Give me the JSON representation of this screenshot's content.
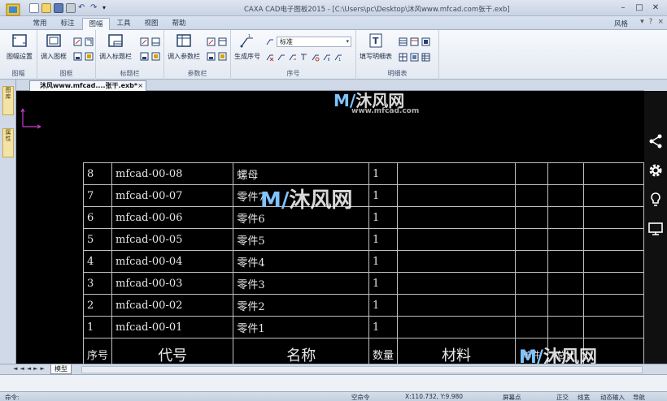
{
  "window": {
    "title": "CAXA CAD电子图板2015 - [C:\\Users\\pc\\Desktop\\沐风www.mfcad.com张干.exb]",
    "style_label": "风格"
  },
  "tabs": [
    "常用",
    "标注",
    "图幅",
    "工具",
    "视图",
    "帮助"
  ],
  "active_tab": "图幅",
  "ribbon": {
    "groups": [
      {
        "label": "图幅",
        "buttons": [
          "图幅设置"
        ]
      },
      {
        "label": "图框",
        "buttons": [
          "调入图框"
        ]
      },
      {
        "label": "标题栏",
        "buttons": [
          "调入标题栏"
        ]
      },
      {
        "label": "参数栏",
        "buttons": [
          "调入参数栏"
        ]
      },
      {
        "label": "序号",
        "buttons": [
          "生成序号"
        ],
        "dropdown_value": "标准"
      },
      {
        "label": "明细表",
        "buttons": [
          "填写明细表"
        ]
      }
    ]
  },
  "document": {
    "tab_title": "沐风www.mfcad....张干.exb*",
    "close_glyph": "×"
  },
  "left_panel": {
    "tabs": [
      "图库",
      "属性"
    ]
  },
  "bom": {
    "rows": [
      {
        "no": "8",
        "code": "mfcad-00-08",
        "name": "螺母",
        "qty": "1"
      },
      {
        "no": "7",
        "code": "mfcad-00-07",
        "name": "零件7",
        "qty": "1"
      },
      {
        "no": "6",
        "code": "mfcad-00-06",
        "name": "零件6",
        "qty": "1"
      },
      {
        "no": "5",
        "code": "mfcad-00-05",
        "name": "零件5",
        "qty": "1"
      },
      {
        "no": "4",
        "code": "mfcad-00-04",
        "name": "零件4",
        "qty": "1"
      },
      {
        "no": "3",
        "code": "mfcad-00-03",
        "name": "零件3",
        "qty": "1"
      },
      {
        "no": "2",
        "code": "mfcad-00-02",
        "name": "零件2",
        "qty": "1"
      },
      {
        "no": "1",
        "code": "mfcad-00-01",
        "name": "零件1",
        "qty": "1"
      }
    ],
    "header": {
      "no": "序号",
      "code": "代号",
      "name": "名称",
      "qty": "数量",
      "material": "材料",
      "unit": "单件",
      "total": "总计"
    }
  },
  "watermarks": {
    "brand": "沐风网",
    "url": "www.mfcad.com"
  },
  "right_tools": [
    "share-icon",
    "gear-icon",
    "bulb-icon",
    "monitor-icon"
  ],
  "sheet": {
    "tab": "模型",
    "nav": "◄◄◄►►"
  },
  "command": {
    "prompt": "命令:"
  },
  "status": {
    "mode": "空命令",
    "coords": "X:110.732, Y:9.980",
    "snap": "屏幕点",
    "ortho": "正交",
    "linewidth": "线宽",
    "dynamic_input": "动态输入",
    "nav": "导航"
  },
  "colors": {
    "canvas": "#000000",
    "ucs": "#c53fd0",
    "ribbon": "#e3e9f2"
  }
}
